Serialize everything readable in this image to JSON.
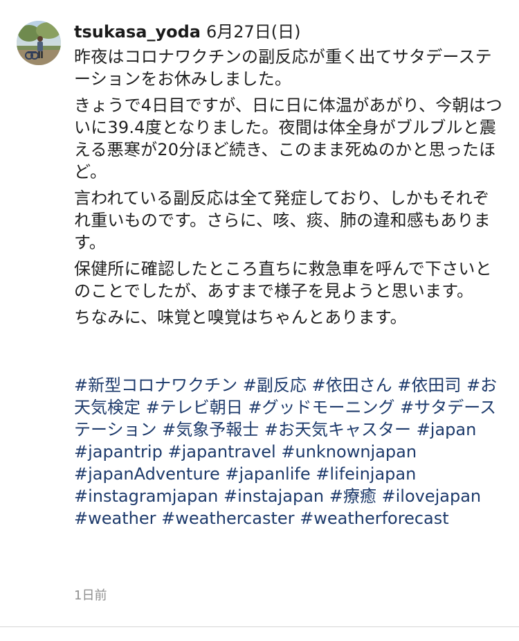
{
  "post": {
    "username": "tsukasa_yoda",
    "date": "6月27日(日)",
    "paragraphs": [
      "昨夜はコロナワクチンの副反応が重く出てサタデーステーションをお休みしました。",
      "きょうで4日目ですが、日に日に体温があがり、今朝はついに39.4度となりました。夜間は体全身がブルブルと震える悪寒が20分ほど続き、このまま死ぬのかと思ったほど。",
      "言われている副反応は全て発症しており、しかもそれぞれ重いものです。さらに、咳、痰、肺の違和感もあります。",
      "保健所に確認したところ直ちに救急車を呼んで下さいとのことでしたが、あすまで様子を見ようと思います。",
      "ちなみに、味覚と嗅覚はちゃんとあります。"
    ],
    "hashtags": [
      "#新型コロナワクチン",
      "#副反応",
      "#依田さん",
      "#依田司",
      "#お天気検定",
      "#テレビ朝日",
      "#グッドモーニング",
      "#サタデーステーション",
      "#気象予報士",
      "#お天気キャスター",
      "#japan",
      "#japantrip",
      "#japantravel",
      "#unknownjapan",
      "#japanAdventure",
      "#japanlife",
      "#lifeinjapan",
      "#instagramjapan",
      "#instajapan",
      "#療癒",
      "#ilovejapan",
      "#weather",
      "#weathercaster",
      "#weatherforecast"
    ],
    "timestamp": "1日前",
    "hashtag_color": "#1d3a6b",
    "timestamp_color": "#8e8e8e"
  }
}
